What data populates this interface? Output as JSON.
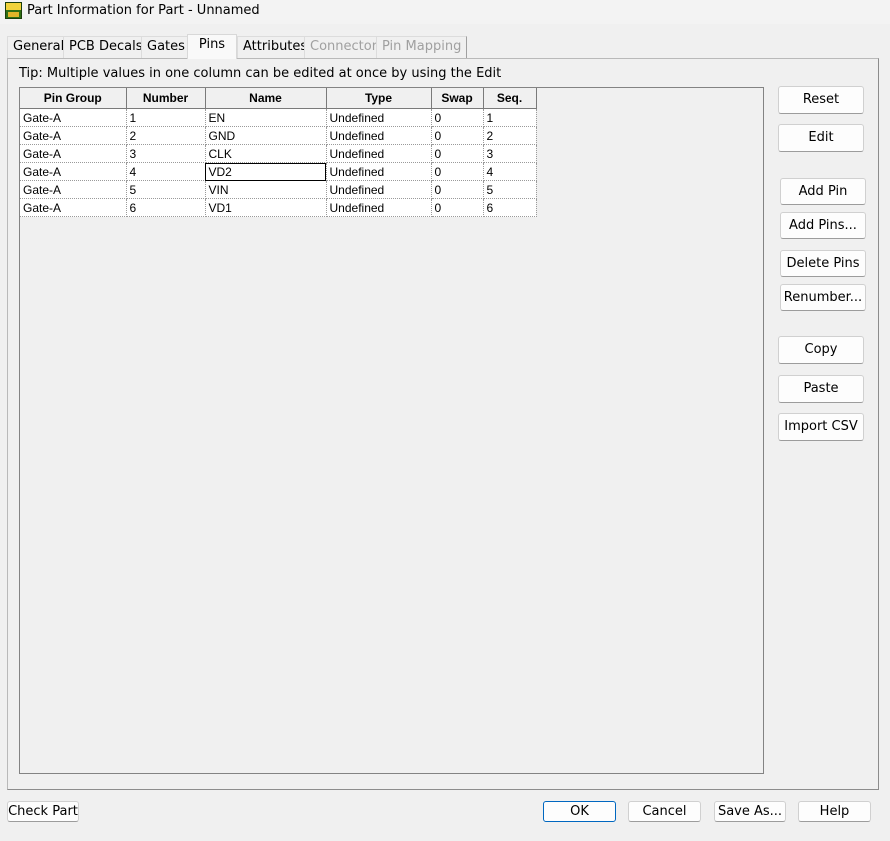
{
  "window": {
    "title": "Part Information for Part - Unnamed",
    "icon": "pads-app-icon"
  },
  "tabs": [
    {
      "label": "General",
      "active": false,
      "enabled": true
    },
    {
      "label": "PCB Decals",
      "active": false,
      "enabled": true
    },
    {
      "label": "Gates",
      "active": false,
      "enabled": true
    },
    {
      "label": "Pins",
      "active": true,
      "enabled": true
    },
    {
      "label": "Attributes",
      "active": false,
      "enabled": true
    },
    {
      "label": "Connector",
      "active": false,
      "enabled": false
    },
    {
      "label": "Pin Mapping",
      "active": false,
      "enabled": false
    }
  ],
  "tip": "Tip: Multiple values in one column can be edited at once by using the Edit",
  "grid": {
    "columns": [
      "Pin Group",
      "Number",
      "Name",
      "Type",
      "Swap",
      "Seq."
    ],
    "rows": [
      [
        "Gate-A",
        "1",
        "EN",
        "Undefined",
        "0",
        "1"
      ],
      [
        "Gate-A",
        "2",
        "GND",
        "Undefined",
        "0",
        "2"
      ],
      [
        "Gate-A",
        "3",
        "CLK",
        "Undefined",
        "0",
        "3"
      ],
      [
        "Gate-A",
        "4",
        "VD2",
        "Undefined",
        "0",
        "4"
      ],
      [
        "Gate-A",
        "5",
        "VIN",
        "Undefined",
        "0",
        "5"
      ],
      [
        "Gate-A",
        "6",
        "VD1",
        "Undefined",
        "0",
        "6"
      ]
    ],
    "selected_cell": {
      "row": 4,
      "column": "Name"
    }
  },
  "side_buttons": {
    "reset": "Reset",
    "edit": "Edit",
    "add_pin": "Add Pin",
    "add_pins": "Add Pins...",
    "delete_pins": "Delete Pins",
    "renumber": "Renumber...",
    "copy": "Copy",
    "paste": "Paste",
    "import_csv": "Import CSV"
  },
  "footer": {
    "check_part": "Check Part",
    "ok": "OK",
    "cancel": "Cancel",
    "save_as": "Save As...",
    "help": "Help"
  },
  "colors": {
    "default_button_border": "#0067c0",
    "dialog_bg": "#f0f0f0",
    "cell_bg": "#ffffff",
    "disabled_text": "#a0a0a0"
  }
}
